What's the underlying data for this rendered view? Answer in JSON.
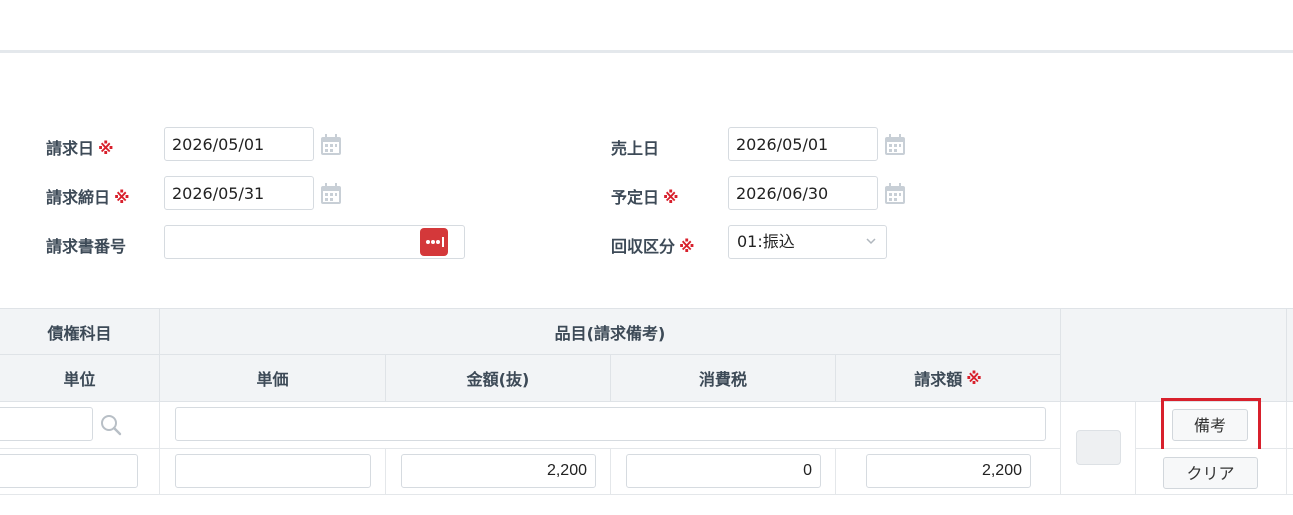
{
  "form": {
    "invoice_date": {
      "label": "請求日",
      "required": "※",
      "value": "2026/05/01"
    },
    "closing_date": {
      "label": "請求締日",
      "required": "※",
      "value": "2026/05/31"
    },
    "invoice_no": {
      "label": "請求書番号",
      "value": ""
    },
    "sales_date": {
      "label": "売上日",
      "value": "2026/05/01"
    },
    "due_date": {
      "label": "予定日",
      "required": "※",
      "value": "2026/06/30"
    },
    "collection_type": {
      "label": "回収区分",
      "required": "※",
      "value": "01:振込"
    }
  },
  "table": {
    "headers": {
      "receivable_item": "債権科目",
      "item_remarks": "品目(請求備考)",
      "unit": "単位",
      "unit_price": "単価",
      "amount": "金額(抜)",
      "tax": "消費税",
      "billing_amount": "請求額",
      "billing_required": "※"
    },
    "row": {
      "unit_price": "",
      "amount": "2,200",
      "tax": "0",
      "billing_amount": "2,200"
    },
    "buttons": {
      "remarks": "備考",
      "clear": "クリア"
    }
  },
  "colors": {
    "required": "#d8202c",
    "header_bg": "#f2f4f6",
    "dots_button": "#d4383a"
  }
}
